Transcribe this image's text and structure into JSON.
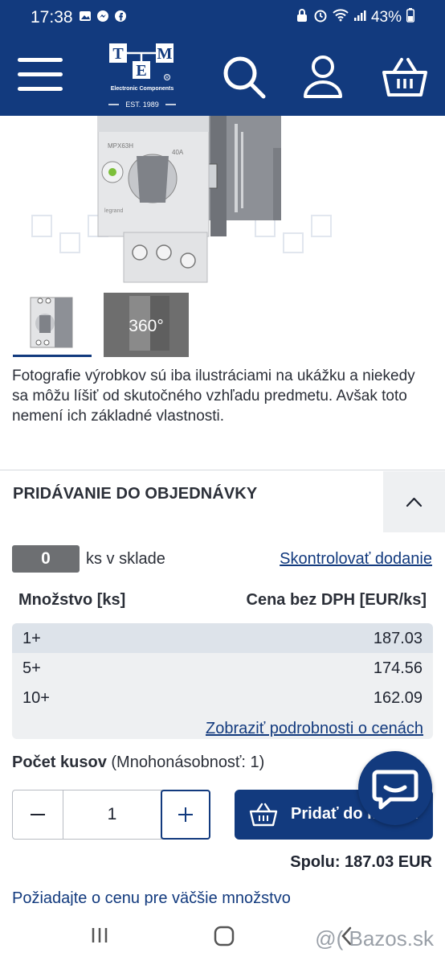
{
  "status_bar": {
    "time": "17:38",
    "battery": "43%",
    "icons": [
      "gallery-icon",
      "messenger-icon",
      "facebook-icon",
      "lock-icon",
      "alarm-icon",
      "wifi-icon",
      "signal-icon",
      "battery-icon"
    ]
  },
  "header": {
    "logo_letters": [
      "T",
      "M",
      "E"
    ],
    "logo_subtitle": "Electronic Components",
    "logo_est": "EST. 1989",
    "registered": "®",
    "icons": [
      "menu-icon",
      "search-icon",
      "user-icon",
      "cart-icon"
    ]
  },
  "gallery": {
    "product_label": "MPX63H",
    "rating": "40A",
    "brand": "legrand",
    "thumb_360_label": "360°"
  },
  "disclaimer": "Fotografie výrobkov sú iba ilustráciami na ukážku a niekedy sa môžu líšiť od skutočného vzhľadu predmetu. Avšak toto nemení ich základné vlastnosti.",
  "order": {
    "title": "PRIDÁVANIE DO OBJEDNÁVKY",
    "stock_count": "0",
    "stock_text": "ks v sklade",
    "check_delivery_link": "Skontrolovať dodanie",
    "col_quantity": "Množstvo [ks]",
    "col_price": "Cena bez DPH [EUR/ks]",
    "price_rows": [
      {
        "qty": "1+",
        "price": "187.03"
      },
      {
        "qty": "5+",
        "price": "174.56"
      },
      {
        "qty": "10+",
        "price": "162.09"
      }
    ],
    "price_details_link": "Zobraziť podrobnosti o cenách",
    "qty_label_bold": "Počet kusov",
    "qty_label_rest": " (Mnohonásobnosť: 1)",
    "qty_value": "1",
    "minus_symbol": "−",
    "plus_symbol": "+",
    "add_button_label": "Pridať do košíka",
    "total": "Spolu: 187.03 EUR",
    "big_quantity_link": "Požiadajte o cenu pre väčšie množstvo"
  },
  "navbar": {
    "watermark": "@( Bazos.sk"
  },
  "colors": {
    "brand_blue": "#123a7e",
    "badge_grey": "#6d6f72",
    "table_bg": "#eef0f2"
  }
}
